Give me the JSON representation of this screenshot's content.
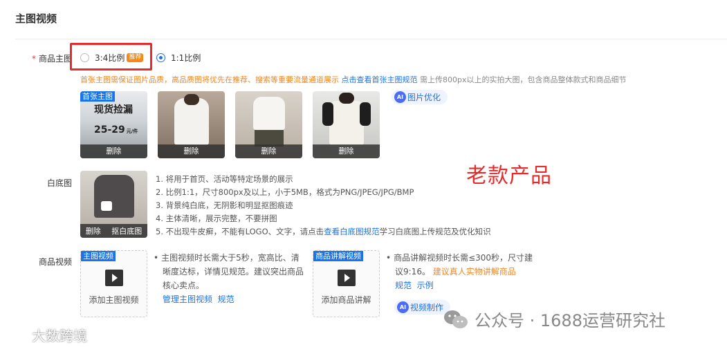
{
  "section_title": "主图视频",
  "main_image": {
    "label": "商品主图",
    "required_mark": "*",
    "ratio_34": "3:4比例",
    "recommend_tag": "推荐",
    "ratio_11": "1:1比例",
    "tip_orange": "首张主图需保证图片品质，高品质图将优先在推荐、搜索等重要流量通道展示",
    "tip_link": "点击查看首张主图规范",
    "tip_grey": "需上传800px以上的实拍大图，包含商品整体款式和商品细节",
    "first_badge": "首张主图",
    "first_overlay_line1": "现货捡漏",
    "first_overlay_line2": "25-29",
    "first_overlay_unit": "元/件",
    "delete_label": "删除",
    "ai_button": "图片优化"
  },
  "annotation": "老款产品",
  "white_bg": {
    "label": "白底图",
    "delete_label": "删除",
    "cutout_label": "抠白底图",
    "rules": [
      "1. 将用于首页、活动等特定场景的展示",
      "2. 比例1:1，尺寸800px及以上，小于5MB，格式为PNG/JPEG/JPG/BMP",
      "3. 背景纯白底，无阴影和明显抠图痕迹",
      "4. 主体清晰，展示完整，不要拼图"
    ],
    "rule5_a": "5. 不出现牛皮癣，不能有LOGO、文字，请点击",
    "rule5_link": "查看白底图规范",
    "rule5_b": "学习白底图上传规范及优化知识"
  },
  "video": {
    "label": "商品视频",
    "main_badge": "主图视频",
    "main_add": "添加主图视频",
    "main_tip": [
      "主图视频时长需大于5秒，宽高比、清",
      "晰度达标，详情见规范。建议突出商品",
      "核心卖点。"
    ],
    "main_link1": "管理主图视频",
    "main_link2": "规范",
    "explain_badge": "商品讲解视频",
    "explain_add": "添加商品讲解",
    "explain_tip1": "商品讲解视频时长需≤300秒，尺寸建",
    "explain_tip2a": "议9:16。",
    "explain_tip2b": "建议真人实物讲解商品",
    "explain_link1": "规范",
    "explain_link2": "示例",
    "ai_button": "视频制作"
  },
  "watermark": "公众号 · 1688运营研究社",
  "watermark2": "大数跨境"
}
